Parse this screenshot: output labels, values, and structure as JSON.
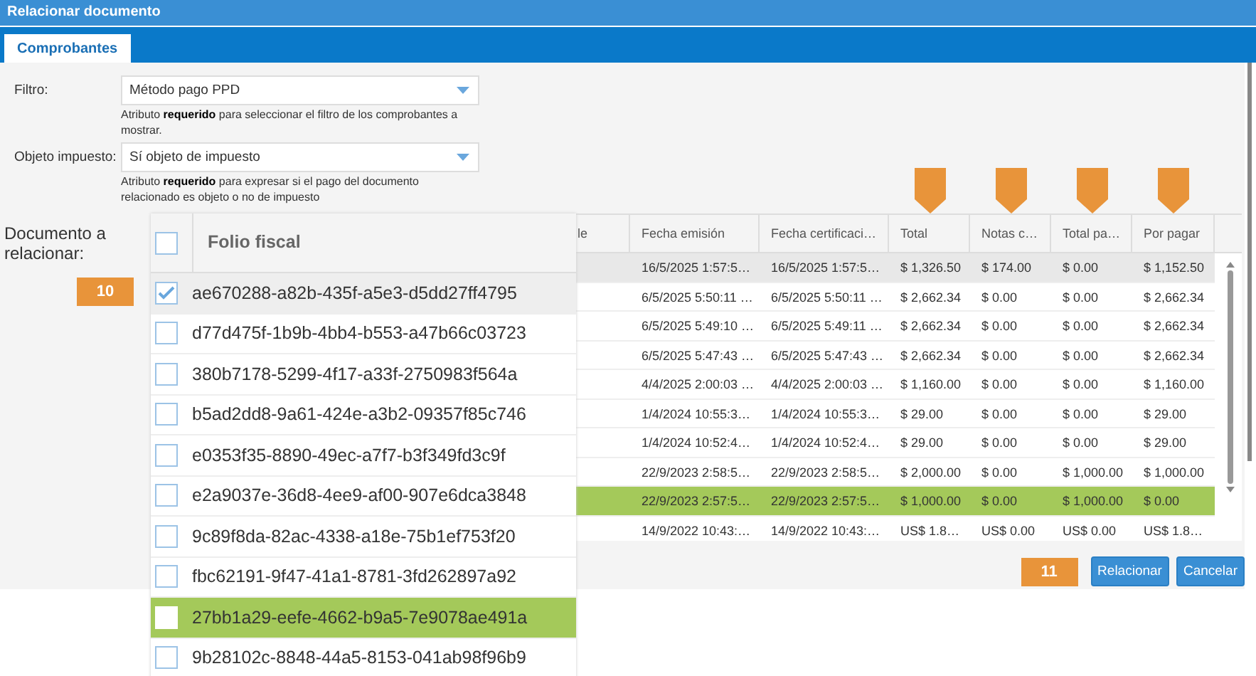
{
  "window": {
    "title": "Relacionar documento"
  },
  "tabs": [
    {
      "label": "Comprobantes",
      "selected": true
    }
  ],
  "form": [
    {
      "label": "Filtro:",
      "value": "Método pago PPD",
      "hint": "Atributo **requerido** para seleccionar el filtro de los comprobantes a mostrar."
    },
    {
      "label": "Objeto impuesto:",
      "value": "Sí objeto de impuesto",
      "hint": "Atributo **requerido** para expresar si el pago del documento relacionado es objeto o no de impuesto"
    }
  ],
  "table": {
    "columns": [
      {
        "label": "le",
        "marked": false
      },
      {
        "label": "Fecha emisión",
        "marked": false
      },
      {
        "label": "Fecha certificaci…",
        "marked": false
      },
      {
        "label": "Total",
        "marked": true
      },
      {
        "label": "Notas c…",
        "marked": true
      },
      {
        "label": "Total pa…",
        "marked": true
      },
      {
        "label": "Por pagar",
        "marked": true
      }
    ],
    "rows": [
      {
        "selected": true,
        "highlighted": false,
        "cells": [
          "",
          "16/5/2025 1:57:5…",
          "16/5/2025 1:57:5…",
          "$ 1,326.50",
          "$ 174.00",
          "$ 0.00",
          "$ 1,152.50"
        ]
      },
      {
        "selected": false,
        "highlighted": false,
        "cells": [
          "",
          "6/5/2025 5:50:11 …",
          "6/5/2025 5:50:11 …",
          "$ 2,662.34",
          "$ 0.00",
          "$ 0.00",
          "$ 2,662.34"
        ]
      },
      {
        "selected": false,
        "highlighted": false,
        "cells": [
          "",
          "6/5/2025 5:49:10 …",
          "6/5/2025 5:49:11 …",
          "$ 2,662.34",
          "$ 0.00",
          "$ 0.00",
          "$ 2,662.34"
        ]
      },
      {
        "selected": false,
        "highlighted": false,
        "cells": [
          "",
          "6/5/2025 5:47:43 …",
          "6/5/2025 5:47:43 …",
          "$ 2,662.34",
          "$ 0.00",
          "$ 0.00",
          "$ 2,662.34"
        ]
      },
      {
        "selected": false,
        "highlighted": false,
        "cells": [
          "",
          "4/4/2025 2:00:03 …",
          "4/4/2025 2:00:03 …",
          "$ 1,160.00",
          "$ 0.00",
          "$ 0.00",
          "$ 1,160.00"
        ]
      },
      {
        "selected": false,
        "highlighted": false,
        "cells": [
          "",
          "1/4/2024 10:55:3…",
          "1/4/2024 10:55:3…",
          "$ 29.00",
          "$ 0.00",
          "$ 0.00",
          "$ 29.00"
        ]
      },
      {
        "selected": false,
        "highlighted": false,
        "cells": [
          "",
          "1/4/2024 10:52:4…",
          "1/4/2024 10:52:4…",
          "$ 29.00",
          "$ 0.00",
          "$ 0.00",
          "$ 29.00"
        ]
      },
      {
        "selected": false,
        "highlighted": false,
        "cells": [
          "",
          "22/9/2023 2:58:5…",
          "22/9/2023 2:58:5…",
          "$ 2,000.00",
          "$ 0.00",
          "$ 1,000.00",
          "$ 1,000.00"
        ]
      },
      {
        "selected": false,
        "highlighted": true,
        "cells": [
          "",
          "22/9/2023 2:57:5…",
          "22/9/2023 2:57:5…",
          "$ 1,000.00",
          "$ 0.00",
          "$ 1,000.00",
          "$ 0.00"
        ]
      },
      {
        "selected": false,
        "highlighted": false,
        "cells": [
          "",
          "14/9/2022 10:43:…",
          "14/9/2022 10:43:…",
          "US$ 1.8…",
          "US$ 0.00",
          "US$ 0.00",
          "US$ 1.8…"
        ]
      }
    ]
  },
  "zoom_panel": {
    "label": "Documento a relacionar:",
    "column": "Folio fiscal",
    "all_checked": false,
    "callout": "10",
    "rows": [
      {
        "folio": "ae670288-a82b-435f-a5e3-d5dd27ff4795",
        "checked": true,
        "selected": true,
        "highlighted": false
      },
      {
        "folio": "d77d475f-1b9b-4bb4-b553-a47b66c03723",
        "checked": false,
        "selected": false,
        "highlighted": false
      },
      {
        "folio": "380b7178-5299-4f17-a33f-2750983f564a",
        "checked": false,
        "selected": false,
        "highlighted": false
      },
      {
        "folio": "b5ad2dd8-9a61-424e-a3b2-09357f85c746",
        "checked": false,
        "selected": false,
        "highlighted": false
      },
      {
        "folio": "e0353f35-8890-49ec-a7f7-b3f349fd3c9f",
        "checked": false,
        "selected": false,
        "highlighted": false
      },
      {
        "folio": "e2a9037e-36d8-4ee9-af00-907e6dca3848",
        "checked": false,
        "selected": false,
        "highlighted": false
      },
      {
        "folio": "9c89f8da-82ac-4338-a18e-75b1ef753f20",
        "checked": false,
        "selected": false,
        "highlighted": false
      },
      {
        "folio": "fbc62191-9f47-41a1-8781-3fd262897a92",
        "checked": false,
        "selected": false,
        "highlighted": false
      },
      {
        "folio": "27bb1a29-eefe-4662-b9a5-7e9078ae491a",
        "checked": false,
        "selected": false,
        "highlighted": true
      },
      {
        "folio": "9b28102c-8848-44a5-8153-041ab98f96b9",
        "checked": false,
        "selected": false,
        "highlighted": false
      }
    ]
  },
  "footer": {
    "callout": "11",
    "buttons": [
      "Relacionar",
      "Cancelar"
    ]
  }
}
